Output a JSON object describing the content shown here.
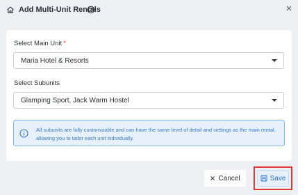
{
  "header": {
    "title": "Add Multi-Unit Rentals",
    "icons": [
      "home-icon",
      "help-icon",
      "close-icon"
    ]
  },
  "form": {
    "main_unit": {
      "label": "Select Main Unit",
      "required_marker": "*",
      "value": "Maria Hotel & Resorts"
    },
    "subunits": {
      "label": "Select Subunits",
      "value": "Glamping Sport, Jack Warm Hostel"
    },
    "info_text": "All subunits are fully customizable and can have the same level of detail and settings as the main rental, allowing you to tailor each unit individually."
  },
  "footer": {
    "cancel_label": "Cancel",
    "save_label": "Save"
  },
  "colors": {
    "required": "#e23b3b",
    "info_background": "#e6f1fc",
    "info_border": "#7fb4ea",
    "info_text": "#3d78c9",
    "save_text": "#2f6fd0",
    "highlight": "#e03838"
  }
}
